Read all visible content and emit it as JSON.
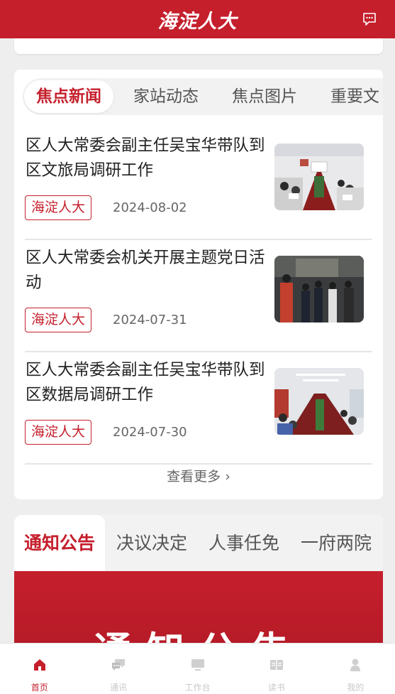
{
  "header": {
    "title": "海淀人大"
  },
  "news_tabs": [
    "焦点新闻",
    "家站动态",
    "焦点图片",
    "重要文"
  ],
  "news": [
    {
      "title": "区人大常委会副主任吴宝华带队到区文旅局调研工作",
      "tag": "海淀人大",
      "date": "2024-08-02"
    },
    {
      "title": "区人大常委会机关开展主题党日活动",
      "tag": "海淀人大",
      "date": "2024-07-31"
    },
    {
      "title": "区人大常委会副主任吴宝华带队到区数据局调研工作",
      "tag": "海淀人大",
      "date": "2024-07-30"
    }
  ],
  "more_label": "查看更多",
  "notice_tabs": [
    "通知公告",
    "决议决定",
    "人事任免",
    "一府两院"
  ],
  "banner_text": "通知公告",
  "nav": [
    "首页",
    "通讯",
    "工作台",
    "读书",
    "我的"
  ],
  "colors": {
    "brand": "#c51f2c"
  }
}
